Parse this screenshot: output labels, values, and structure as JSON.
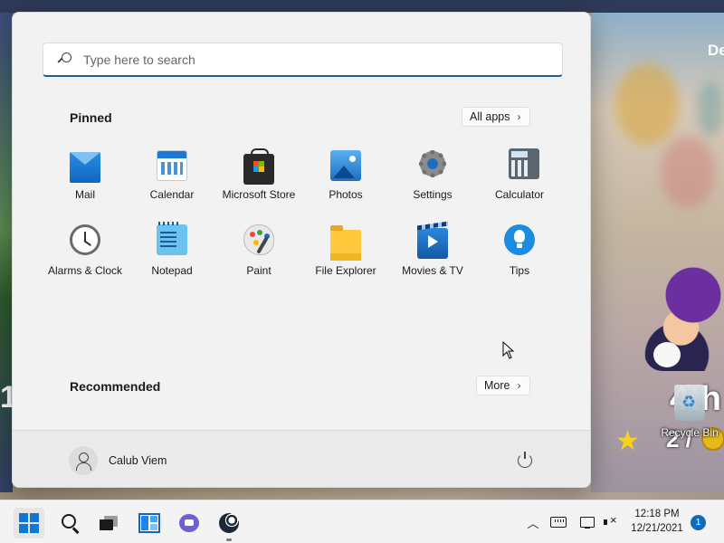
{
  "wallpaper": {
    "text_right": "De",
    "big_text_left": "1",
    "rank": "4th",
    "score": "2 /"
  },
  "desktop": {
    "recycle_bin_label": "Recycle Bin"
  },
  "start_menu": {
    "search": {
      "placeholder": "Type here to search",
      "value": ""
    },
    "pinned_title": "Pinned",
    "all_apps_label": "All apps",
    "pinned_apps": [
      {
        "label": "Mail",
        "icon": "mail-icon"
      },
      {
        "label": "Calendar",
        "icon": "calendar-icon"
      },
      {
        "label": "Microsoft Store",
        "icon": "store-icon"
      },
      {
        "label": "Photos",
        "icon": "photos-icon"
      },
      {
        "label": "Settings",
        "icon": "gear-icon"
      },
      {
        "label": "Calculator",
        "icon": "calculator-icon"
      },
      {
        "label": "Alarms & Clock",
        "icon": "clock-icon"
      },
      {
        "label": "Notepad",
        "icon": "notepad-icon"
      },
      {
        "label": "Paint",
        "icon": "paint-palette-icon"
      },
      {
        "label": "File Explorer",
        "icon": "folder-icon"
      },
      {
        "label": "Movies & TV",
        "icon": "film-play-icon"
      },
      {
        "label": "Tips",
        "icon": "lightbulb-icon"
      }
    ],
    "recommended_title": "Recommended",
    "more_label": "More",
    "user_name": "Calub Viem"
  },
  "taskbar": {
    "time": "12:18 PM",
    "date": "12/21/2021",
    "notification_count": "1",
    "accent_color": "#0f78d4"
  }
}
